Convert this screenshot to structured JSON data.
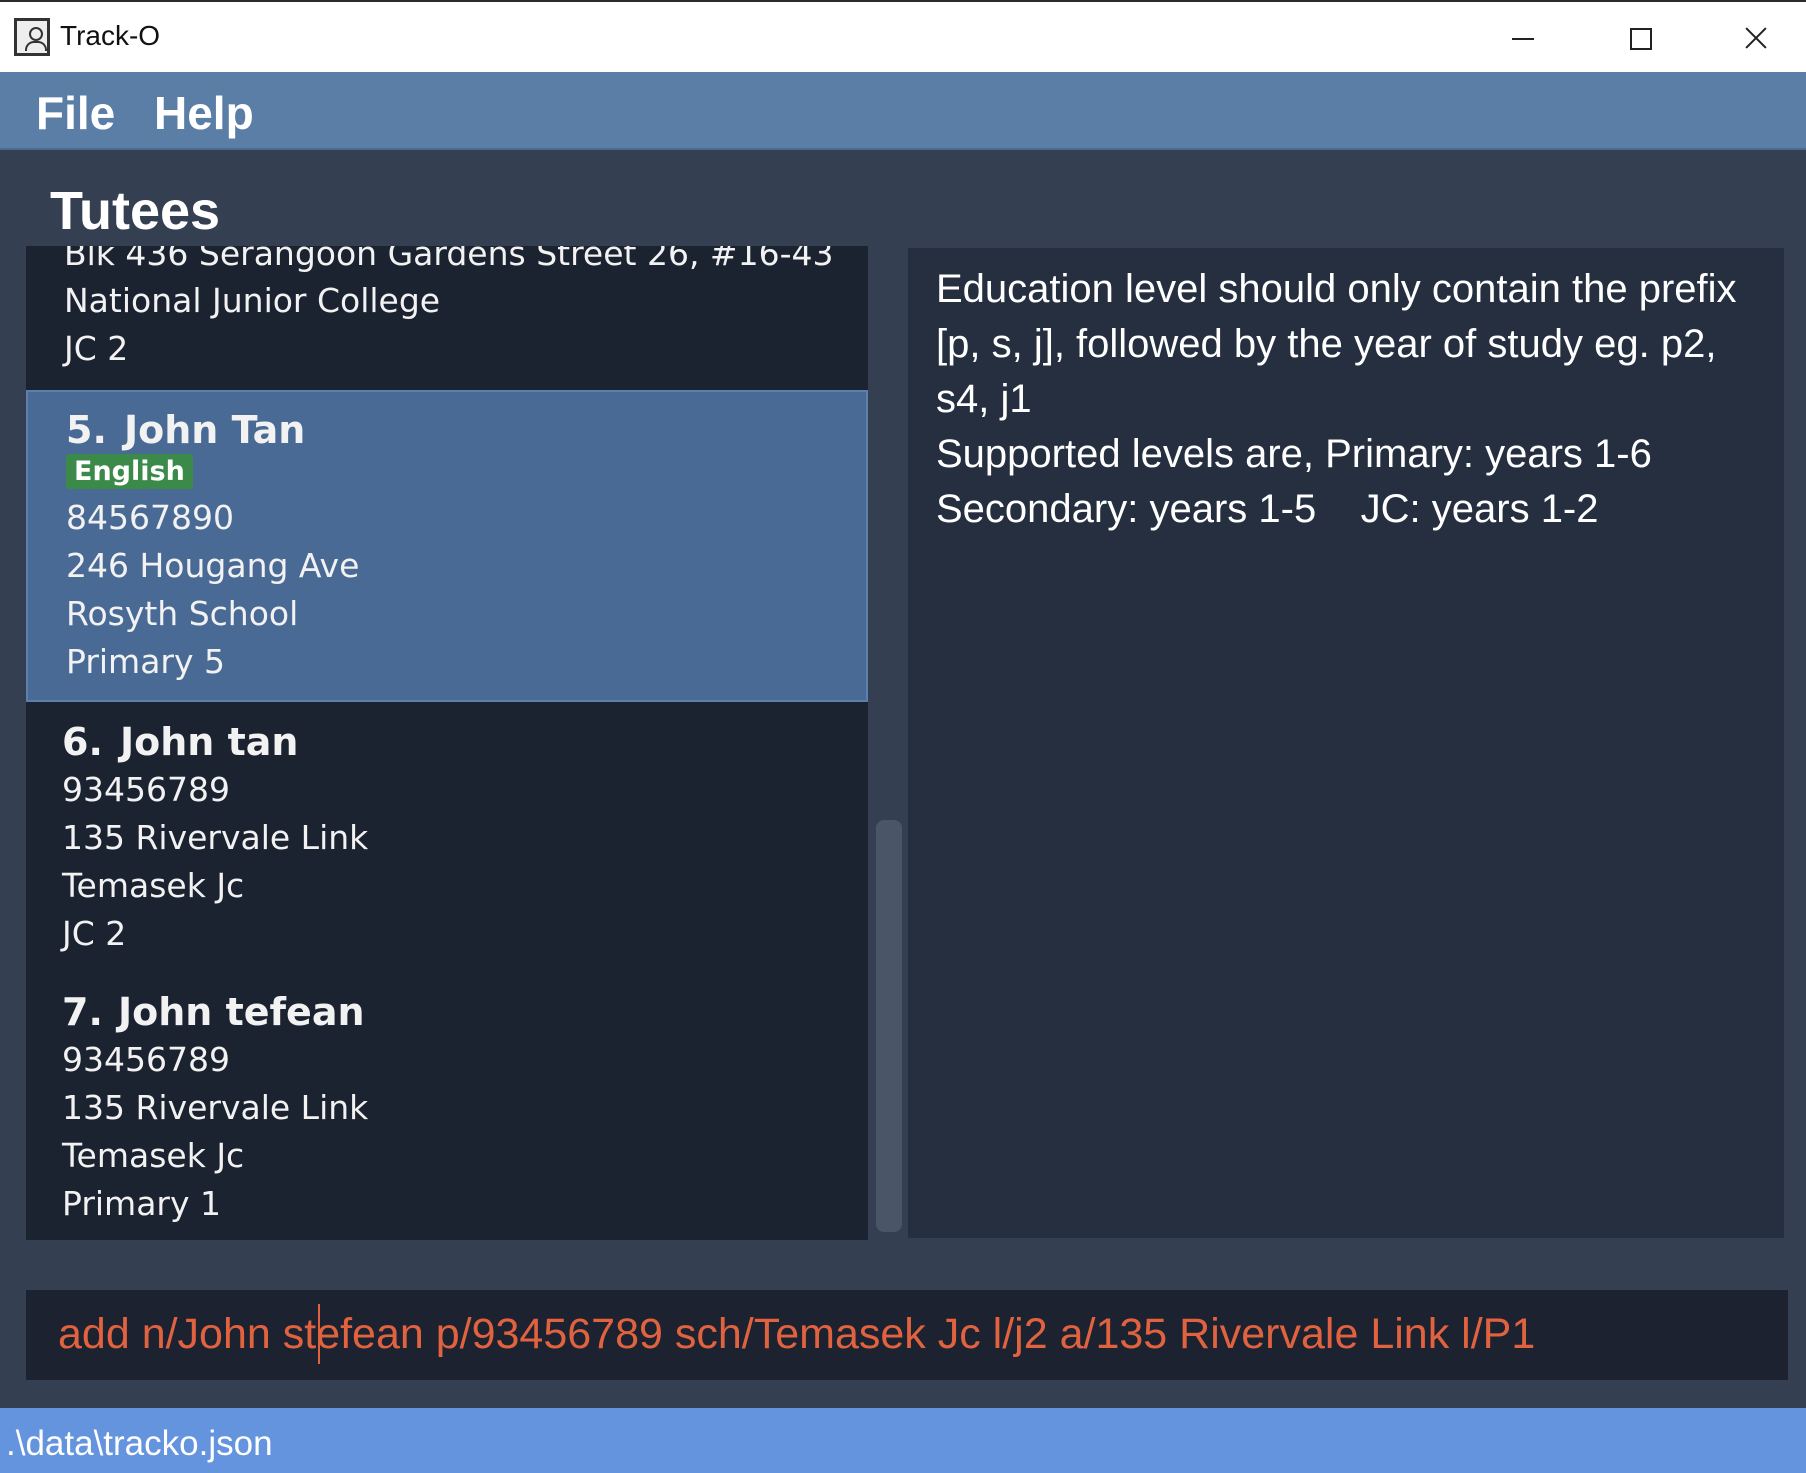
{
  "window": {
    "title": "Track-O",
    "icon": "contact-book-icon",
    "controls": [
      "minimize-icon",
      "maximize-icon",
      "close-icon"
    ]
  },
  "menu": {
    "file": "File",
    "help": "Help"
  },
  "panel_title": "Tutees",
  "tutees": {
    "partial": {
      "address": "Blk 436 Serangoon Gardens Street 26, #16-43",
      "school": "National Junior College",
      "level": "JC 2"
    },
    "t5": {
      "index": "5.",
      "name": "John Tan",
      "tag": "English",
      "phone": "84567890",
      "address": "246 Hougang Ave",
      "school": "Rosyth School",
      "level": "Primary 5"
    },
    "t6": {
      "index": "6.",
      "name": "John tan",
      "phone": "93456789",
      "address": "135 Rivervale Link",
      "school": "Temasek Jc",
      "level": "JC 2"
    },
    "t7": {
      "index": "7.",
      "name": "John tefean",
      "phone": "93456789",
      "address": "135 Rivervale Link",
      "school": "Temasek Jc",
      "level": "Primary 1"
    }
  },
  "result": {
    "line1": "Education level should only contain the prefix",
    "line2": "[p, s, j], followed by the year of study eg. p2,",
    "line3": "s4, j1",
    "line4": "Supported levels are, Primary: years 1-6",
    "line5": "Secondary: years 1-5    JC: years 1-2"
  },
  "command": {
    "value": "add n/John stefean p/93456789 sch/Temasek Jc l/j2 a/135 Rivervale Link l/P1"
  },
  "status": {
    "file_path": ".\\data\\tracko.json"
  },
  "colors": {
    "background": "#343f52",
    "menubar": "#5b7ea7",
    "list_bg": "#1b2230",
    "selected": "#4a6a96",
    "tag": "#3b8a4a",
    "command_text": "#e0623f",
    "statusbar": "#6394dd"
  }
}
